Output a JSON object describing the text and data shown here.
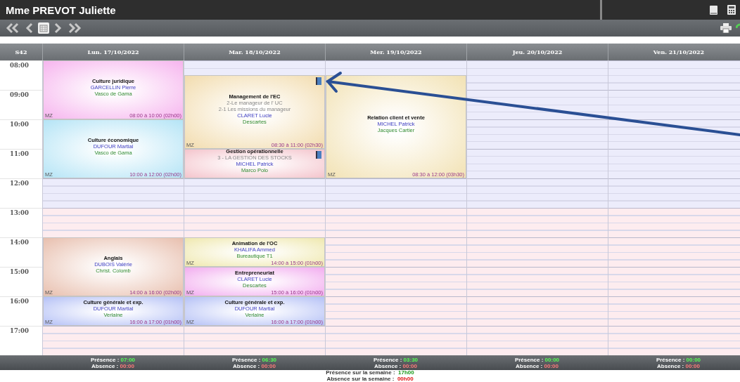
{
  "title": "Mme PREVOT Juliette",
  "week": "S42",
  "hours": [
    "08:00",
    "09:00",
    "10:00",
    "11:00",
    "12:00",
    "13:00",
    "14:00",
    "15:00",
    "16:00",
    "17:00"
  ],
  "days": [
    {
      "label": "Lun. 17/10/2022",
      "presence_label": "Présence :",
      "presence": "07:00",
      "absence_label": "Absence :",
      "absence": "00:00",
      "events": [
        {
          "title": "Culture juridique",
          "teacher": "GARCELLIN Pierre",
          "room": "Vasco de Gama",
          "code": "MZ",
          "time": "08:00 à 10:00 (02h00)",
          "color": "#f6b4ee",
          "book": false
        },
        {
          "title": "Culture économique",
          "teacher": "DUFOUR Martial",
          "room": "Vasco de Gama",
          "code": "MZ",
          "time": "10:00 à 12:00 (02h00)",
          "color": "#b4e4f6",
          "book": false
        },
        {
          "title": "Anglais",
          "teacher": "DUBOIS Valérie",
          "room": "Christ. Colomb",
          "code": "MZ",
          "time": "14:00 à 16:00 (02h00)",
          "color": "#e8bfae",
          "book": false
        },
        {
          "title": "Culture générale et exp.",
          "teacher": "DUFOUR Martial",
          "room": "Verlaine",
          "code": "MZ",
          "time": "16:00 à 17:00 (01h00)",
          "color": "#b4c0f6",
          "book": false
        }
      ]
    },
    {
      "label": "Mar. 18/10/2022",
      "presence_label": "Présence :",
      "presence": "06:30",
      "absence_label": "Absence :",
      "absence": "00:00",
      "events": [
        {
          "title": "Management de l'EC",
          "topics": [
            "2-Le manageur de l' UC",
            "2-1 Les missions du manageur"
          ],
          "teacher": "CLARET Lucie",
          "room": "Descartes",
          "code": "MZ",
          "time": "08:30 à 11:00 (02h30)",
          "color": "#f2dcae",
          "book": true
        },
        {
          "title": "Gestion opérationnelle",
          "topics": [
            "3 - LA GESTION DES STOCKS"
          ],
          "teacher": "MICHEL Patrick",
          "room": "Marco Polo",
          "color": "#f4c4cc",
          "book": true
        },
        {
          "title": "Animation de l'OC",
          "teacher": "KHALIFA Ammed",
          "room": "Bureautique T1",
          "code": "MZ",
          "time": "14:00 à 15:00 (01h00)",
          "color": "#efe8ae",
          "book": false
        },
        {
          "title": "Entrepreneuriat",
          "teacher": "CLARET Lucie",
          "room": "Descartes",
          "code": "MZ",
          "time": "15:00 à 16:00 (01h00)",
          "color": "#f2acef",
          "book": false
        },
        {
          "title": "Culture générale et exp.",
          "teacher": "DUFOUR Martial",
          "room": "Verlaine",
          "code": "MZ",
          "time": "16:00 à 17:00 (01h00)",
          "color": "#b4c0f6",
          "book": false
        }
      ]
    },
    {
      "label": "Mer. 19/10/2022",
      "presence_label": "Présence :",
      "presence": "03:30",
      "absence_label": "Absence :",
      "absence": "00:00",
      "events": [
        {
          "title": "Relation client et vente",
          "teacher": "MICHEL Patrick",
          "room": "Jacques Cartier",
          "code": "MZ",
          "time": "08:30 à 12:00 (03h30)",
          "color": "#f2e2b4",
          "book": false
        }
      ]
    },
    {
      "label": "Jeu. 20/10/2022",
      "presence_label": "Présence :",
      "presence": "00:00",
      "absence_label": "Absence :",
      "absence": "00:00"
    },
    {
      "label": "Ven. 21/10/2022",
      "presence_label": "Présence :",
      "presence": "00:00",
      "absence_label": "Absence :",
      "absence": "00:00"
    }
  ],
  "summary": [
    {
      "label": "Présence sur la semaine :",
      "value": "17h00",
      "kind": "presence"
    },
    {
      "label": "Absence sur la semaine :",
      "value": "00h00",
      "kind": "absence"
    }
  ]
}
